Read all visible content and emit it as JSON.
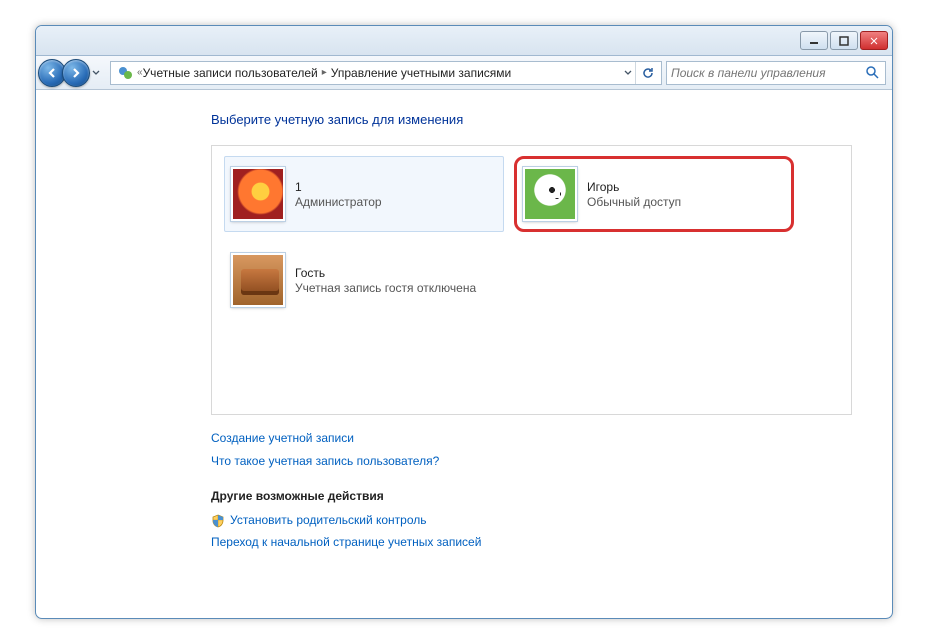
{
  "breadcrumb": {
    "item1": "Учетные записи пользователей",
    "item2": "Управление учетными записями"
  },
  "search": {
    "placeholder": "Поиск в панели управления"
  },
  "heading": "Выберите учетную запись для изменения",
  "accounts": [
    {
      "name": "1",
      "type": "Администратор"
    },
    {
      "name": "Игорь",
      "type": "Обычный доступ"
    },
    {
      "name": "Гость",
      "type": "Учетная запись гостя отключена"
    }
  ],
  "links": {
    "create": "Создание учетной записи",
    "whatis": "Что такое учетная запись пользователя?"
  },
  "other_header": "Другие возможные действия",
  "other_links": {
    "parental": "Установить родительский контроль",
    "goto": "Переход к начальной странице учетных записей"
  }
}
